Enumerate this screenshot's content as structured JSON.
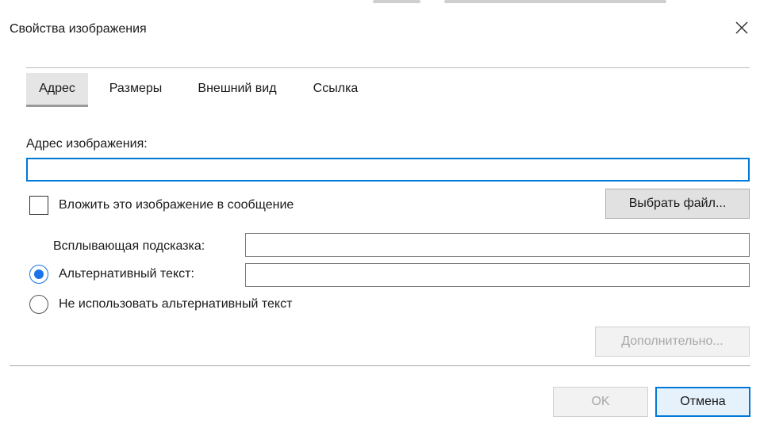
{
  "dialog": {
    "title": "Свойства изображения",
    "tabs": [
      {
        "label": "Адрес",
        "active": true
      },
      {
        "label": "Размеры",
        "active": false
      },
      {
        "label": "Внешний вид",
        "active": false
      },
      {
        "label": "Ссылка",
        "active": false
      }
    ],
    "image_address": {
      "label": "Адрес изображения:",
      "value": "",
      "placeholder": ""
    },
    "embed": {
      "checkbox_label": "Вложить это изображение в сообщение",
      "checked": false,
      "choose_file_label": "Выбрать файл..."
    },
    "tooltip": {
      "label": "Всплывающая подсказка:",
      "value": ""
    },
    "alt_text": {
      "radio_label": "Альтернативный текст:",
      "selected": true,
      "value": ""
    },
    "no_alt": {
      "radio_label": "Не использовать альтернативный текст",
      "selected": false
    },
    "advanced_label": "Дополнительно...",
    "ok_label": "OK",
    "cancel_label": "Отмена"
  },
  "colors": {
    "accent": "#0078d7",
    "radio_fill": "#1a73e8",
    "active_tab_bg": "#e5e5e5",
    "button_bg": "#e1e1e1"
  },
  "icons": {
    "close": "close-icon",
    "radio_on": "radio-checked-icon",
    "radio_off": "radio-unchecked-icon",
    "checkbox": "checkbox-icon"
  }
}
